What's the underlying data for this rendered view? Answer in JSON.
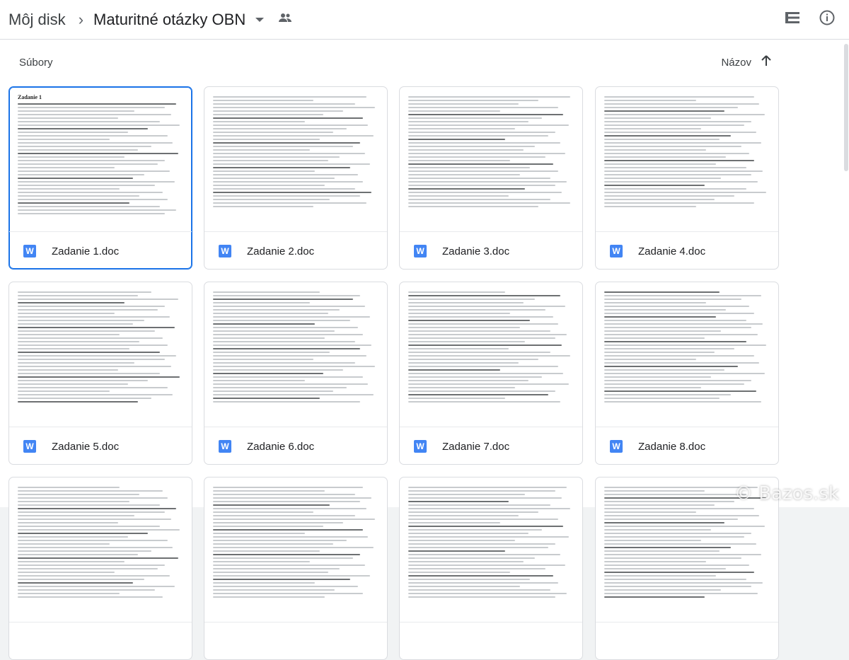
{
  "breadcrumb": {
    "root": "Môj disk",
    "separator": "›",
    "current": "Maturitné otázky OBN"
  },
  "toolbar": {
    "list_view_icon": "list-view-icon",
    "info_icon": "info-icon",
    "shared_icon": "people-icon"
  },
  "section_label": "Súbory",
  "sort": {
    "label": "Názov",
    "direction_icon": "arrow-up-icon"
  },
  "files": [
    {
      "name": "Zadanie 1.doc",
      "preview_title": "Zadanie 1",
      "selected": true
    },
    {
      "name": "Zadanie 2.doc",
      "preview_title": "",
      "selected": false
    },
    {
      "name": "Zadanie 3.doc",
      "preview_title": "",
      "selected": false
    },
    {
      "name": "Zadanie 4.doc",
      "preview_title": "",
      "selected": false
    },
    {
      "name": "Zadanie 5.doc",
      "preview_title": "",
      "selected": false
    },
    {
      "name": "Zadanie 6.doc",
      "preview_title": "",
      "selected": false
    },
    {
      "name": "Zadanie 7.doc",
      "preview_title": "",
      "selected": false
    },
    {
      "name": "Zadanie 8.doc",
      "preview_title": "",
      "selected": false
    },
    {
      "name": "",
      "preview_title": "",
      "selected": false
    },
    {
      "name": "",
      "preview_title": "",
      "selected": false
    },
    {
      "name": "",
      "preview_title": "",
      "selected": false
    },
    {
      "name": "",
      "preview_title": "",
      "selected": false
    }
  ],
  "doc_icon_letter": "W",
  "watermark": "© Bazos.sk",
  "colors": {
    "accent": "#1a73e8",
    "doc_icon": "#4285f4"
  }
}
